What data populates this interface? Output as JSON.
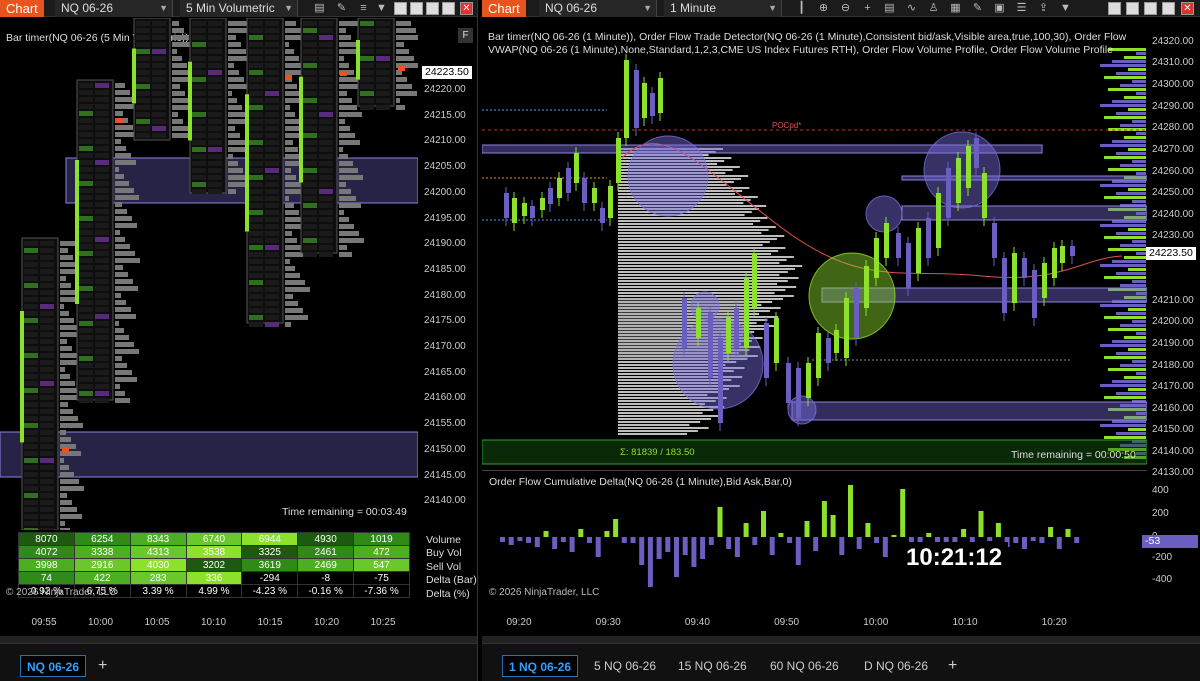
{
  "left": {
    "chart_tab": "Chart",
    "instrument": "NQ 06-26",
    "interval": "5 Min Volumetric",
    "indicator_label": "Bar timer(NQ 06-26 (5 Min Volumetric))",
    "price_badge": "24223.50",
    "price_ticks": [
      "24220.00",
      "24215.00",
      "24210.00",
      "24205.00",
      "24200.00",
      "24195.00",
      "24190.00",
      "24185.00",
      "24180.00",
      "24175.00",
      "24170.00",
      "24165.00",
      "24160.00",
      "24155.00",
      "24150.00",
      "24145.00",
      "24140.00"
    ],
    "time_remaining": "Time remaining = 00:03:49",
    "time_ticks": [
      "09:55",
      "10:00",
      "10:05",
      "10:10",
      "10:15",
      "10:20",
      "10:25"
    ],
    "copyright": "© 2026 NinjaTrader, LLC",
    "stats": {
      "labels": [
        "Volume",
        "Buy Vol",
        "Sell Vol",
        "Delta (Bar)",
        "Delta (%)"
      ],
      "rows": [
        [
          "8070",
          "6254",
          "8343",
          "6740",
          "6944",
          "4930",
          "1019"
        ],
        [
          "4072",
          "3338",
          "4313",
          "3538",
          "3325",
          "2461",
          "472"
        ],
        [
          "3998",
          "2916",
          "4030",
          "3202",
          "3619",
          "2469",
          "547"
        ],
        [
          "74",
          "422",
          "283",
          "336",
          "-294",
          "-8",
          "-75"
        ],
        [
          "0.92 %",
          "6.75 %",
          "3.39 %",
          "4.99 %",
          "-4.23 %",
          "-0.16 %",
          "-7.36 %"
        ]
      ]
    },
    "tabs": [
      {
        "label": "NQ 06-26",
        "active": true
      }
    ],
    "add_tab": "+"
  },
  "right": {
    "chart_tab": "Chart",
    "instrument": "NQ 06-26",
    "interval": "1 Minute",
    "indicator_label": "Bar timer(NQ 06-26 (1 Minute)), Order Flow Trade Detector(NQ 06-26 (1 Minute),Consistent bid/ask,Visible area,true,100,30), Order Flow VWAP(NQ 06-26 (1 Minute),None,Standard,1,2,3,CME US Index Futures RTH), Order Flow Volume Profile, Order Flow Volume Profile",
    "poc_label": "POCpd*",
    "sigma_label": "Σ: 81839 / 183.50",
    "time_remaining": "Time remaining = 00:00:50",
    "price_badge": "24223.50",
    "price_ticks": [
      "24320.00",
      "24310.00",
      "24300.00",
      "24290.00",
      "24280.00",
      "24270.00",
      "24260.00",
      "24250.00",
      "24240.00",
      "24230.00",
      "24210.00",
      "24200.00",
      "24190.00",
      "24180.00",
      "24170.00",
      "24160.00",
      "24150.00",
      "24140.00",
      "24130.00"
    ],
    "delta_label": "Order Flow Cumulative Delta(NQ 06-26 (1 Minute),Bid Ask,Bar,0)",
    "delta_ticks": [
      "400",
      "200",
      "0",
      "-200",
      "-400"
    ],
    "delta_badge": "-53",
    "clock": "10:21:12",
    "copyright": "© 2026 NinjaTrader, LLC",
    "time_ticks": [
      "09:20",
      "09:30",
      "09:40",
      "09:50",
      "10:00",
      "10:10",
      "10:20"
    ],
    "tabs": [
      {
        "label": "1 NQ 06-26",
        "active": true
      },
      {
        "label": "5 NQ 06-26",
        "active": false
      },
      {
        "label": "15 NQ 06-26",
        "active": false
      },
      {
        "label": "60 NQ 06-26",
        "active": false
      },
      {
        "label": "D NQ 06-26",
        "active": false
      }
    ],
    "add_tab": "+"
  },
  "colors": {
    "accent": "#e8541e",
    "bull": "#8de02c",
    "bear": "#6a5fc0",
    "zone": "#6e64c8",
    "vwap": "#e05050",
    "profile": "#bdbdbd"
  }
}
